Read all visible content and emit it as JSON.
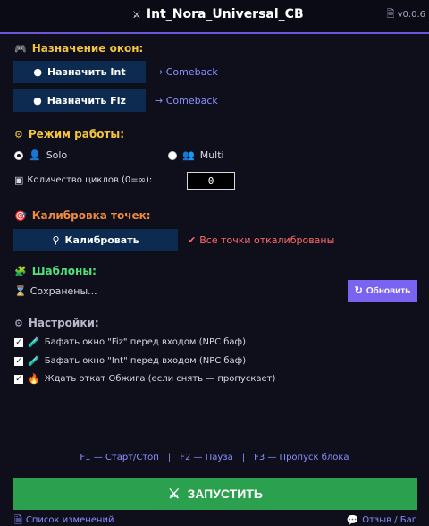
{
  "window": {
    "title": "Int_Nora_Universal_CB",
    "title_icon": "⚔",
    "version": "v0.0.6"
  },
  "sections": {
    "windows": {
      "title": "Назначение окон:",
      "icon": "🎮",
      "assign_int_label": "Назначить Int",
      "assign_fiz_label": "Назначить Fiz",
      "int_link": "→ Comeback",
      "fiz_link": "→ Comeback"
    },
    "mode": {
      "title": "Режим работы:",
      "icon": "⚙",
      "solo_label": "Solo",
      "multi_label": "Multi",
      "selected": "Solo",
      "cycles_label": "Количество циклов (0=∞):",
      "cycles_value": "0"
    },
    "calibration": {
      "title": "Калибровка точек:",
      "icon": "🎯",
      "button_label": "Калибровать",
      "status": "Все точки откалиброваны",
      "status_icon": "✔"
    },
    "templates": {
      "title": "Шаблоны:",
      "icon": "🧩",
      "saved_text": "Сохранены...",
      "saved_icon": "⌛",
      "refresh_label": "Обновить",
      "refresh_icon": "↻"
    },
    "settings": {
      "title": "Настройки:",
      "icon": "⚙",
      "options": [
        {
          "label": "Бафать окно \"Fiz\" перед входом (NPC баф)",
          "checked": true
        },
        {
          "label": "Бафать окно \"Int\" перед входом (NPC баф)",
          "checked": true
        },
        {
          "label": "Ждать откат Обжига (если снять — пропускает)",
          "checked": true
        }
      ]
    }
  },
  "hotkeys": {
    "start_stop": "F1 — Старт/Стоп",
    "pause": "F2 — Пауза",
    "skip": "F3 — Пропуск блока",
    "separator": "|"
  },
  "start_button": {
    "label": "ЗАПУСТИТЬ",
    "icon": "⚔"
  },
  "footer": {
    "changelog": "Список изменений",
    "feedback": "Отзыв / Баг"
  },
  "colors": {
    "background": "#0f0f1c",
    "accent_purple": "#7a63f0",
    "start_green": "#2ba14f",
    "button_navy": "#0d2a50",
    "link_blue": "#8a90ff",
    "status_red": "#ff6a6a",
    "heading_yellow": "#f3c43c",
    "heading_orange": "#f08a3e",
    "heading_green": "#4fe07a"
  }
}
